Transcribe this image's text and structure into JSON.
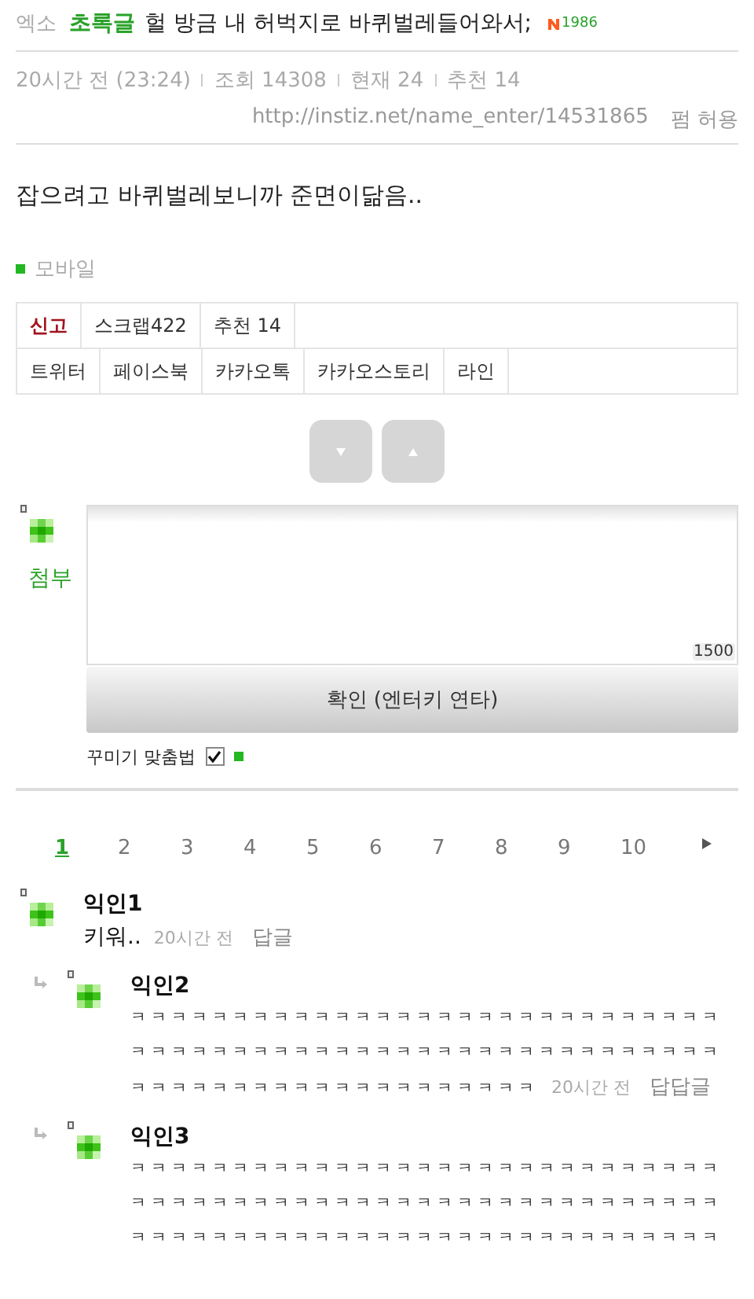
{
  "header": {
    "category": "엑소",
    "label": "초록글",
    "title": "헐 방금 내 허벅지로 바퀴벌레들어와서;",
    "badge_count": "1986"
  },
  "meta": [
    "20시간 전 (23:24)",
    "조회 14308",
    "현재 24",
    "추천 14"
  ],
  "url": "http://instiz.net/name_enter/14531865",
  "permission": "펌 허용",
  "body": "잡으려고 바퀴벌레보니까 준면이닮음..",
  "device": "모바일",
  "actions": [
    {
      "label": "신고",
      "kind": "report"
    },
    {
      "label": "스크랩422",
      "kind": "normal"
    },
    {
      "label": "추천 14",
      "kind": "normal"
    }
  ],
  "share": [
    "트위터",
    "페이스북",
    "카카오톡",
    "카카오스토리",
    "라인"
  ],
  "comment_form": {
    "attach": "첨부",
    "counter": "1500",
    "submit": "확인 (엔터키 연타)",
    "decor_label": "꾸미기 맞춤법",
    "decor_checked": true
  },
  "pages": [
    {
      "label": "1",
      "selected": true
    },
    {
      "label": "2",
      "selected": false
    },
    {
      "label": "3",
      "selected": false
    },
    {
      "label": "4",
      "selected": false
    },
    {
      "label": "5",
      "selected": false
    },
    {
      "label": "6",
      "selected": false
    },
    {
      "label": "7",
      "selected": false
    },
    {
      "label": "8",
      "selected": false
    },
    {
      "label": "9",
      "selected": false
    },
    {
      "label": "10",
      "selected": false
    }
  ],
  "comments": [
    {
      "author": "익인1",
      "reply": false,
      "lines": [
        "키워.."
      ],
      "time": "20시간 전",
      "action": "답글"
    },
    {
      "author": "익인2",
      "reply": true,
      "lines": [
        "ㅋㅋㅋㅋㅋㅋㅋㅋㅋㅋㅋㅋㅋㅋㅋㅋㅋㅋㅋㅋㅋㅋㅋㅋㅋㅋㅋㅋㅋ",
        "ㅋㅋㅋㅋㅋㅋㅋㅋㅋㅋㅋㅋㅋㅋㅋㅋㅋㅋㅋㅋㅋㅋㅋㅋㅋㅋㅋㅋㅋ",
        "ㅋㅋㅋㅋㅋㅋㅋㅋㅋㅋㅋㅋㅋㅋㅋㅋㅋㅋㅋㅋ"
      ],
      "time": "20시간 전",
      "action": "답답글"
    },
    {
      "author": "익인3",
      "reply": true,
      "lines": [
        "ㅋㅋㅋㅋㅋㅋㅋㅋㅋㅋㅋㅋㅋㅋㅋㅋㅋㅋㅋㅋㅋㅋㅋㅋㅋㅋㅋㅋㅋ",
        "ㅋㅋㅋㅋㅋㅋㅋㅋㅋㅋㅋㅋㅋㅋㅋㅋㅋㅋㅋㅋㅋㅋㅋㅋㅋㅋㅋㅋㅋ",
        "ㅋㅋㅋㅋㅋㅋㅋㅋㅋㅋㅋㅋㅋㅋㅋㅋㅋㅋㅋㅋㅋㅋㅋㅋㅋㅋㅋㅋㅋ"
      ]
    }
  ]
}
